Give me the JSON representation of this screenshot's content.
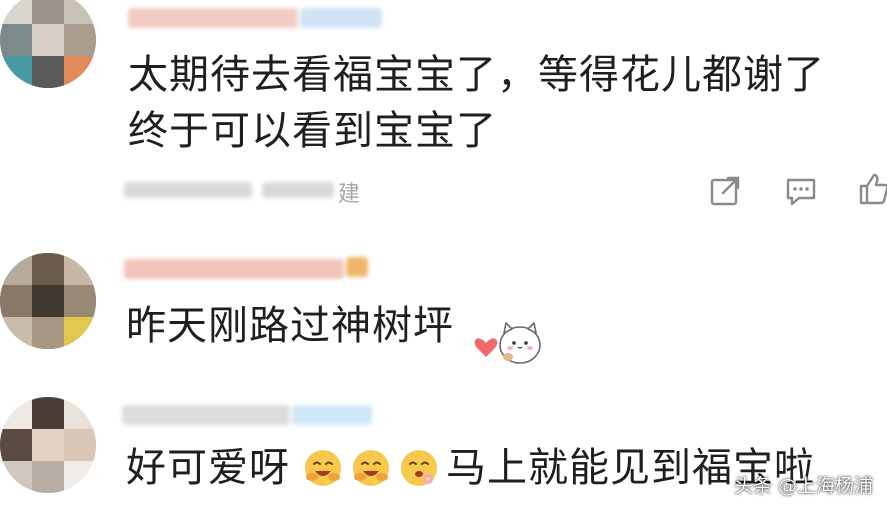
{
  "comments": [
    {
      "text_line1": "太期待去看福宝宝了，等得花儿都谢了",
      "text_line2": "终于可以看到宝宝了",
      "location_suffix": "建",
      "actions": [
        "share-icon",
        "reply-icon",
        "like-icon"
      ]
    },
    {
      "text": "昨天刚路过神树坪",
      "sticker": "cat-heart-sticker"
    },
    {
      "text_before": "好可爱呀",
      "emojis": [
        "hugging-face-emoji",
        "hugging-face-emoji",
        "flower-face-emoji"
      ],
      "text_after": "马上就能见到福宝啦"
    }
  ],
  "watermark": "头条 @上海杨浦",
  "colors": {
    "text": "#1f1f1f",
    "meta": "#a8a8a8",
    "name_blur_pink": "#f7c9c4",
    "name_blur_blue": "#cfe6f7",
    "emoji": "#f6c84c"
  }
}
